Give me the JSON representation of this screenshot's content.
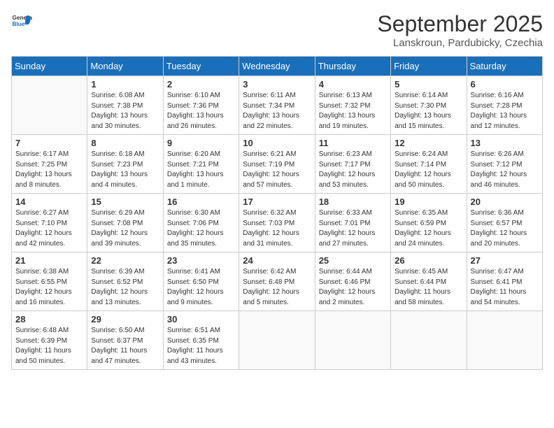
{
  "logo": {
    "text_general": "General",
    "text_blue": "Blue"
  },
  "title": "September 2025",
  "subtitle": "Lanskroun, Pardubicky, Czechia",
  "days_of_week": [
    "Sunday",
    "Monday",
    "Tuesday",
    "Wednesday",
    "Thursday",
    "Friday",
    "Saturday"
  ],
  "weeks": [
    [
      {
        "day": "",
        "empty": true
      },
      {
        "day": "1",
        "sunrise": "Sunrise: 6:08 AM",
        "sunset": "Sunset: 7:38 PM",
        "daylight": "Daylight: 13 hours and 30 minutes."
      },
      {
        "day": "2",
        "sunrise": "Sunrise: 6:10 AM",
        "sunset": "Sunset: 7:36 PM",
        "daylight": "Daylight: 13 hours and 26 minutes."
      },
      {
        "day": "3",
        "sunrise": "Sunrise: 6:11 AM",
        "sunset": "Sunset: 7:34 PM",
        "daylight": "Daylight: 13 hours and 22 minutes."
      },
      {
        "day": "4",
        "sunrise": "Sunrise: 6:13 AM",
        "sunset": "Sunset: 7:32 PM",
        "daylight": "Daylight: 13 hours and 19 minutes."
      },
      {
        "day": "5",
        "sunrise": "Sunrise: 6:14 AM",
        "sunset": "Sunset: 7:30 PM",
        "daylight": "Daylight: 13 hours and 15 minutes."
      },
      {
        "day": "6",
        "sunrise": "Sunrise: 6:16 AM",
        "sunset": "Sunset: 7:28 PM",
        "daylight": "Daylight: 13 hours and 12 minutes."
      }
    ],
    [
      {
        "day": "7",
        "sunrise": "Sunrise: 6:17 AM",
        "sunset": "Sunset: 7:25 PM",
        "daylight": "Daylight: 13 hours and 8 minutes."
      },
      {
        "day": "8",
        "sunrise": "Sunrise: 6:18 AM",
        "sunset": "Sunset: 7:23 PM",
        "daylight": "Daylight: 13 hours and 4 minutes."
      },
      {
        "day": "9",
        "sunrise": "Sunrise: 6:20 AM",
        "sunset": "Sunset: 7:21 PM",
        "daylight": "Daylight: 13 hours and 1 minute."
      },
      {
        "day": "10",
        "sunrise": "Sunrise: 6:21 AM",
        "sunset": "Sunset: 7:19 PM",
        "daylight": "Daylight: 12 hours and 57 minutes."
      },
      {
        "day": "11",
        "sunrise": "Sunrise: 6:23 AM",
        "sunset": "Sunset: 7:17 PM",
        "daylight": "Daylight: 12 hours and 53 minutes."
      },
      {
        "day": "12",
        "sunrise": "Sunrise: 6:24 AM",
        "sunset": "Sunset: 7:14 PM",
        "daylight": "Daylight: 12 hours and 50 minutes."
      },
      {
        "day": "13",
        "sunrise": "Sunrise: 6:26 AM",
        "sunset": "Sunset: 7:12 PM",
        "daylight": "Daylight: 12 hours and 46 minutes."
      }
    ],
    [
      {
        "day": "14",
        "sunrise": "Sunrise: 6:27 AM",
        "sunset": "Sunset: 7:10 PM",
        "daylight": "Daylight: 12 hours and 42 minutes."
      },
      {
        "day": "15",
        "sunrise": "Sunrise: 6:29 AM",
        "sunset": "Sunset: 7:08 PM",
        "daylight": "Daylight: 12 hours and 39 minutes."
      },
      {
        "day": "16",
        "sunrise": "Sunrise: 6:30 AM",
        "sunset": "Sunset: 7:06 PM",
        "daylight": "Daylight: 12 hours and 35 minutes."
      },
      {
        "day": "17",
        "sunrise": "Sunrise: 6:32 AM",
        "sunset": "Sunset: 7:03 PM",
        "daylight": "Daylight: 12 hours and 31 minutes."
      },
      {
        "day": "18",
        "sunrise": "Sunrise: 6:33 AM",
        "sunset": "Sunset: 7:01 PM",
        "daylight": "Daylight: 12 hours and 27 minutes."
      },
      {
        "day": "19",
        "sunrise": "Sunrise: 6:35 AM",
        "sunset": "Sunset: 6:59 PM",
        "daylight": "Daylight: 12 hours and 24 minutes."
      },
      {
        "day": "20",
        "sunrise": "Sunrise: 6:36 AM",
        "sunset": "Sunset: 6:57 PM",
        "daylight": "Daylight: 12 hours and 20 minutes."
      }
    ],
    [
      {
        "day": "21",
        "sunrise": "Sunrise: 6:38 AM",
        "sunset": "Sunset: 6:55 PM",
        "daylight": "Daylight: 12 hours and 16 minutes."
      },
      {
        "day": "22",
        "sunrise": "Sunrise: 6:39 AM",
        "sunset": "Sunset: 6:52 PM",
        "daylight": "Daylight: 12 hours and 13 minutes."
      },
      {
        "day": "23",
        "sunrise": "Sunrise: 6:41 AM",
        "sunset": "Sunset: 6:50 PM",
        "daylight": "Daylight: 12 hours and 9 minutes."
      },
      {
        "day": "24",
        "sunrise": "Sunrise: 6:42 AM",
        "sunset": "Sunset: 6:48 PM",
        "daylight": "Daylight: 12 hours and 5 minutes."
      },
      {
        "day": "25",
        "sunrise": "Sunrise: 6:44 AM",
        "sunset": "Sunset: 6:46 PM",
        "daylight": "Daylight: 12 hours and 2 minutes."
      },
      {
        "day": "26",
        "sunrise": "Sunrise: 6:45 AM",
        "sunset": "Sunset: 6:44 PM",
        "daylight": "Daylight: 11 hours and 58 minutes."
      },
      {
        "day": "27",
        "sunrise": "Sunrise: 6:47 AM",
        "sunset": "Sunset: 6:41 PM",
        "daylight": "Daylight: 11 hours and 54 minutes."
      }
    ],
    [
      {
        "day": "28",
        "sunrise": "Sunrise: 6:48 AM",
        "sunset": "Sunset: 6:39 PM",
        "daylight": "Daylight: 11 hours and 50 minutes."
      },
      {
        "day": "29",
        "sunrise": "Sunrise: 6:50 AM",
        "sunset": "Sunset: 6:37 PM",
        "daylight": "Daylight: 11 hours and 47 minutes."
      },
      {
        "day": "30",
        "sunrise": "Sunrise: 6:51 AM",
        "sunset": "Sunset: 6:35 PM",
        "daylight": "Daylight: 11 hours and 43 minutes."
      },
      {
        "day": "",
        "empty": true
      },
      {
        "day": "",
        "empty": true
      },
      {
        "day": "",
        "empty": true
      },
      {
        "day": "",
        "empty": true
      }
    ]
  ]
}
